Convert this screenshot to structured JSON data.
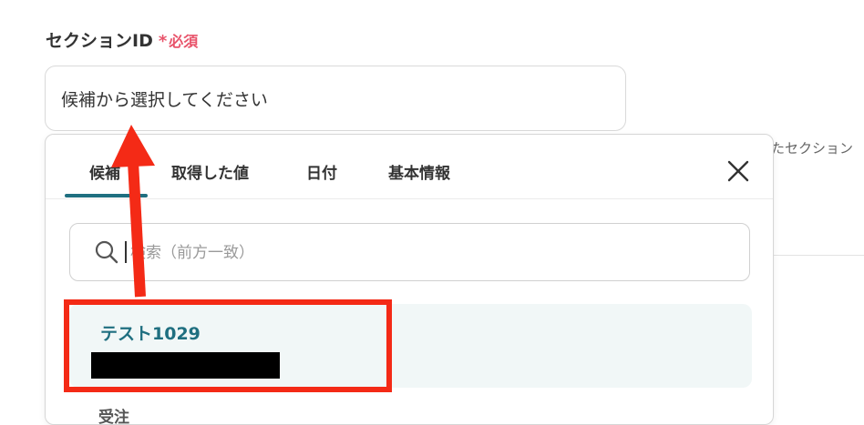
{
  "field": {
    "label": "セクションID",
    "required_star": "*",
    "required_text": "必須"
  },
  "select": {
    "placeholder": "候補から選択してください"
  },
  "background": {
    "hint_text": "たセクション"
  },
  "dropdown": {
    "tabs": [
      {
        "label": "候補",
        "active": true
      },
      {
        "label": "取得した値",
        "active": false
      },
      {
        "label": "日付",
        "active": false
      },
      {
        "label": "基本情報",
        "active": false
      }
    ],
    "search": {
      "placeholder": "検索（前方一致）"
    },
    "options": [
      {
        "title": "テスト1029",
        "subtitle_redacted": true,
        "highlighted": true
      },
      {
        "title": "受注"
      }
    ]
  },
  "colors": {
    "accent": "#1f6f80",
    "required": "#e8536a",
    "annotation": "#f42a16",
    "option_bg": "#f1f7f7"
  },
  "annotations": {
    "arrow": "red arrow pointing up to select box",
    "box": "red rectangle around first option"
  }
}
